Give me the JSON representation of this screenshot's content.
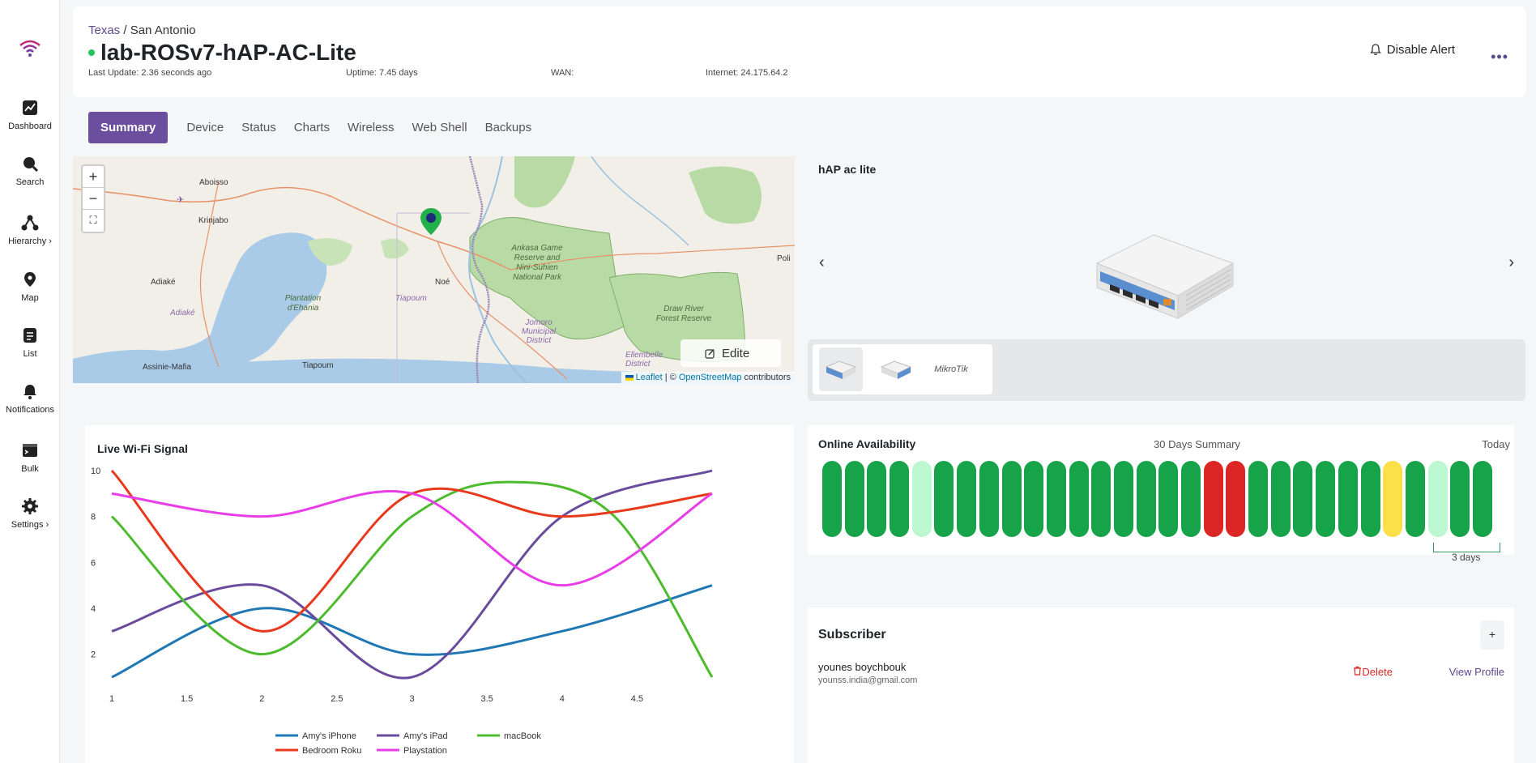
{
  "sidebar": {
    "items": [
      {
        "label": "Dashboard",
        "icon": "chart-icon"
      },
      {
        "label": "Search",
        "icon": "search-icon"
      },
      {
        "label": "Hierarchy ›",
        "icon": "hierarchy-icon"
      },
      {
        "label": "Map",
        "icon": "map-pin-icon"
      },
      {
        "label": "List",
        "icon": "list-icon"
      },
      {
        "label": "Notifications",
        "icon": "bell-icon"
      },
      {
        "label": "Bulk",
        "icon": "terminal-icon"
      },
      {
        "label": "Settings ›",
        "icon": "gear-icon"
      }
    ]
  },
  "header": {
    "breadcrumb_link": "Texas",
    "breadcrumb_sep": " / ",
    "breadcrumb_current": "San Antonio",
    "device_name": "lab-ROSv7-hAP-AC-Lite",
    "last_update": "Last Update: 2.36 seconds ago",
    "uptime": "Uptime: 7.45 days",
    "wan": "WAN:",
    "internet": "Internet: 24.175.64.2",
    "disable_alert": "Disable Alert",
    "more": "•••"
  },
  "tabs": [
    "Summary",
    "Device",
    "Status",
    "Charts",
    "Wireless",
    "Web Shell",
    "Backups"
  ],
  "map": {
    "zoom_in": "+",
    "zoom_out": "−",
    "fullscreen": "⛶",
    "edit_label": "Edite",
    "attrib_leaflet": "Leaflet",
    "attrib_mid": " | © ",
    "attrib_osm": "OpenStreetMap",
    "attrib_end": " contributors",
    "labels": {
      "aboisso": "Aboisso",
      "krinjabo": "Krinjabo",
      "adiake": "Adiaké",
      "adiake_lagoon": "Adiaké",
      "plantation": "Plantation d'Ehania",
      "tiapoum_w": "Tiapoum",
      "noe": "Noé",
      "ankasa": "Ankasa Game Reserve and Nini-Suhien National Park",
      "jomoro": "Jomoro Municipal District",
      "draw_river": "Draw River Forest Reserve",
      "ellembelle": "Ellembelle District",
      "assinie": "Assinie-Mafia",
      "tiapoum": "Tiapoum",
      "poli": "Poli"
    }
  },
  "device": {
    "model": "hAP ac lite",
    "prev": "‹",
    "next": "›",
    "thumb_brand": "MikroTik"
  },
  "wifi": {
    "title": "Live Wi-Fi Signal"
  },
  "chart_data": {
    "type": "line",
    "title": "Live Wi-Fi Signal",
    "x": [
      1,
      1.5,
      2,
      2.5,
      3,
      3.5,
      4,
      4.5,
      5
    ],
    "xticks": [
      1,
      1.5,
      2,
      2.5,
      3,
      3.5,
      4,
      4.5
    ],
    "yticks": [
      2,
      4,
      6,
      8,
      10
    ],
    "xlim": [
      1,
      5
    ],
    "ylim": [
      1,
      10
    ],
    "legend_position": "bottom",
    "series": [
      {
        "name": "Amy's iPhone",
        "color": "#1f77b4",
        "points": [
          [
            1,
            1
          ],
          [
            2,
            4
          ],
          [
            3,
            2
          ],
          [
            4,
            3
          ],
          [
            5,
            5
          ]
        ]
      },
      {
        "name": "Amy's iPad",
        "color": "#6a4c9c",
        "points": [
          [
            1,
            3
          ],
          [
            2,
            5
          ],
          [
            3,
            1
          ],
          [
            4,
            8
          ],
          [
            5,
            10
          ]
        ]
      },
      {
        "name": "macBook",
        "color": "#4cbb2e",
        "points": [
          [
            1,
            8
          ],
          [
            2,
            2
          ],
          [
            3,
            8
          ],
          [
            3.65,
            9.5
          ],
          [
            4.35,
            8
          ],
          [
            5,
            1
          ]
        ]
      },
      {
        "name": "Bedroom Roku",
        "color": "#e8391d",
        "points": [
          [
            1,
            10
          ],
          [
            2,
            3
          ],
          [
            3,
            9
          ],
          [
            4,
            8
          ],
          [
            5,
            9
          ]
        ]
      },
      {
        "name": "Playstation",
        "color": "#e83ee8",
        "points": [
          [
            1,
            9
          ],
          [
            2,
            8
          ],
          [
            3,
            9
          ],
          [
            4,
            5
          ],
          [
            5,
            9
          ]
        ]
      }
    ]
  },
  "availability": {
    "title": "Online Availability",
    "summary": "30 Days Summary",
    "today": "Today",
    "bracket_label": "3 days",
    "days": [
      "up",
      "up",
      "up",
      "up",
      "partial",
      "up",
      "up",
      "up",
      "up",
      "up",
      "up",
      "up",
      "up",
      "up",
      "up",
      "up",
      "up",
      "down",
      "down",
      "up",
      "up",
      "up",
      "up",
      "up",
      "up",
      "warn",
      "up",
      "partial",
      "up",
      "up"
    ],
    "colors": {
      "up": "#16a34a",
      "partial": "#bbf7d0",
      "down": "#dc2626",
      "warn": "#fde047"
    }
  },
  "subscriber": {
    "title": "Subscriber",
    "add": "+",
    "name": "younes boychbouk",
    "email": "younss.india@gmail.com",
    "delete": "Delete",
    "view_profile": "View Profile"
  }
}
